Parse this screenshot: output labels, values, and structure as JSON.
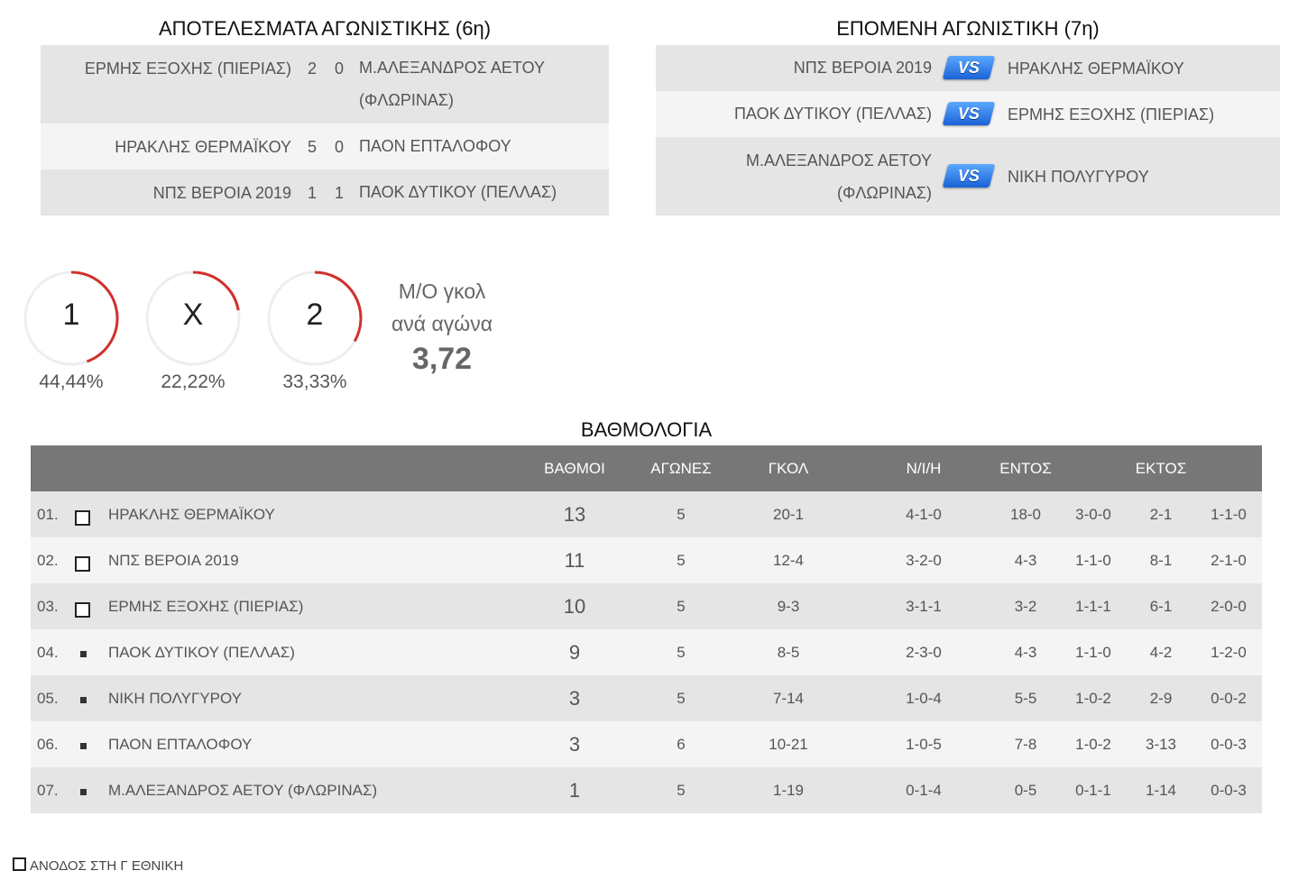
{
  "results_section": {
    "title": "ΑΠΟΤΕΛΕΣΜΑΤΑ ΑΓΩΝΙΣΤΙΚΗΣ (6η)",
    "matches": [
      {
        "home": "ΕΡΜΗΣ ΕΞΟΧΗΣ (ΠΙΕΡΙΑΣ)",
        "home_score": "2",
        "away_score": "0",
        "away": "Μ.ΑΛΕΞΑΝΔΡΟΣ ΑΕΤΟΥ (ΦΛΩΡΙΝΑΣ)"
      },
      {
        "home": "ΗΡΑΚΛΗΣ ΘΕΡΜΑΪΚΟΥ",
        "home_score": "5",
        "away_score": "0",
        "away": "ΠΑΟΝ ΕΠΤΑΛΟΦΟΥ"
      },
      {
        "home": "ΝΠΣ ΒΕΡΟΙΑ 2019",
        "home_score": "1",
        "away_score": "1",
        "away": "ΠΑΟΚ ΔΥΤΙΚΟΥ (ΠΕΛΛΑΣ)"
      }
    ]
  },
  "next_section": {
    "title": "ΕΠΟΜΕΝΗ ΑΓΩΝΙΣΤΙΚΗ (7η)",
    "vs_label": "VS",
    "matches": [
      {
        "home": "ΝΠΣ ΒΕΡΟΙΑ 2019",
        "away": "ΗΡΑΚΛΗΣ ΘΕΡΜΑΪΚΟΥ"
      },
      {
        "home": "ΠΑΟΚ ΔΥΤΙΚΟΥ (ΠΕΛΛΑΣ)",
        "away": "ΕΡΜΗΣ ΕΞΟΧΗΣ (ΠΙΕΡΙΑΣ)"
      },
      {
        "home": "Μ.ΑΛΕΞΑΝΔΡΟΣ ΑΕΤΟΥ (ΦΛΩΡΙΝΑΣ)",
        "away": "ΝΙΚΗ ΠΟΛΥΓΥΡΟΥ"
      }
    ]
  },
  "stats": {
    "gauges": [
      {
        "label": "1",
        "percent_text": "44,44%",
        "fraction": 0.4444
      },
      {
        "label": "Χ",
        "percent_text": "22,22%",
        "fraction": 0.2222
      },
      {
        "label": "2",
        "percent_text": "33,33%",
        "fraction": 0.3333
      }
    ],
    "avg_goals_line1": "Μ/Ο γκολ",
    "avg_goals_line2": "ανά αγώνα",
    "avg_goals_value": "3,72",
    "gauge_color": "#d0312d"
  },
  "standings": {
    "title": "ΒΑΘΜΟΛΟΓΙΑ",
    "headers": {
      "points": "ΒΑΘΜΟΙ",
      "games": "ΑΓΩΝΕΣ",
      "goals": "ΓΚΟΛ",
      "wdl": "Ν/Ι/Η",
      "home": "ΕΝΤΟΣ",
      "away": "ΕΚΤΟΣ"
    },
    "rows": [
      {
        "pos": "01.",
        "marker": "promotion",
        "team": "ΗΡΑΚΛΗΣ ΘΕΡΜΑΪΚΟΥ",
        "points": "13",
        "games": "5",
        "goals": "20-1",
        "wdl": "4-1-0",
        "home_goals": "18-0",
        "home_wdl": "3-0-0",
        "away_goals": "2-1",
        "away_wdl": "1-1-0"
      },
      {
        "pos": "02.",
        "marker": "promotion",
        "team": "ΝΠΣ ΒΕΡΟΙΑ 2019",
        "points": "11",
        "games": "5",
        "goals": "12-4",
        "wdl": "3-2-0",
        "home_goals": "4-3",
        "home_wdl": "1-1-0",
        "away_goals": "8-1",
        "away_wdl": "2-1-0"
      },
      {
        "pos": "03.",
        "marker": "promotion",
        "team": "ΕΡΜΗΣ ΕΞΟΧΗΣ (ΠΙΕΡΙΑΣ)",
        "points": "10",
        "games": "5",
        "goals": "9-3",
        "wdl": "3-1-1",
        "home_goals": "3-2",
        "home_wdl": "1-1-1",
        "away_goals": "6-1",
        "away_wdl": "2-0-0"
      },
      {
        "pos": "04.",
        "marker": "none",
        "team": "ΠΑΟΚ ΔΥΤΙΚΟΥ (ΠΕΛΛΑΣ)",
        "points": "9",
        "games": "5",
        "goals": "8-5",
        "wdl": "2-3-0",
        "home_goals": "4-3",
        "home_wdl": "1-1-0",
        "away_goals": "4-2",
        "away_wdl": "1-2-0"
      },
      {
        "pos": "05.",
        "marker": "none",
        "team": "ΝΙΚΗ ΠΟΛΥΓΥΡΟΥ",
        "points": "3",
        "games": "5",
        "goals": "7-14",
        "wdl": "1-0-4",
        "home_goals": "5-5",
        "home_wdl": "1-0-2",
        "away_goals": "2-9",
        "away_wdl": "0-0-2"
      },
      {
        "pos": "06.",
        "marker": "none",
        "team": "ΠΑΟΝ ΕΠΤΑΛΟΦΟΥ",
        "points": "3",
        "games": "6",
        "goals": "10-21",
        "wdl": "1-0-5",
        "home_goals": "7-8",
        "home_wdl": "1-0-2",
        "away_goals": "3-13",
        "away_wdl": "0-0-3"
      },
      {
        "pos": "07.",
        "marker": "none",
        "team": "Μ.ΑΛΕΞΑΝΔΡΟΣ ΑΕΤΟΥ (ΦΛΩΡΙΝΑΣ)",
        "points": "1",
        "games": "5",
        "goals": "1-19",
        "wdl": "0-1-4",
        "home_goals": "0-5",
        "home_wdl": "0-1-1",
        "away_goals": "1-14",
        "away_wdl": "0-0-3"
      }
    ]
  },
  "legend": {
    "promotion_label": "ΑΝΟΔΟΣ ΣΤΗ Γ ΕΘΝΙΚΗ"
  }
}
